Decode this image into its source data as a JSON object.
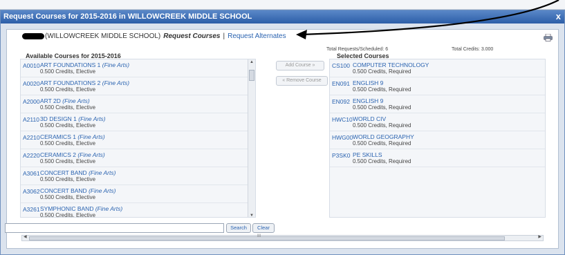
{
  "window": {
    "title": "Request Courses for 2015-2016 in WILLOWCREEK MIDDLE SCHOOL",
    "close_glyph": "x"
  },
  "header": {
    "school": "(WILLOWCREEK MIDDLE SCHOOL)",
    "request_courses": "Request Courses",
    "separator": "|",
    "request_alternates": "Request Alternates"
  },
  "totals": {
    "requests_label": "Total Requests/Scheduled:",
    "requests_value": "6",
    "credits_label": "Total Credits:",
    "credits_value": "3.000"
  },
  "available": {
    "heading": "Available Courses for 2015-2016",
    "courses": [
      {
        "code": "A0010",
        "name": "ART FOUNDATIONS 1",
        "category": "(Fine Arts)",
        "detail": "0.500 Credits, Elective"
      },
      {
        "code": "A0020",
        "name": "ART FOUNDATIONS 2",
        "category": "(Fine Arts)",
        "detail": "0.500 Credits, Elective"
      },
      {
        "code": "A2000",
        "name": "ART 2D",
        "category": "(Fine Arts)",
        "detail": "0.500 Credits, Elective"
      },
      {
        "code": "A2110",
        "name": "3D DESIGN 1",
        "category": "(Fine Arts)",
        "detail": "0.500 Credits, Elective"
      },
      {
        "code": "A2210",
        "name": "CERAMICS 1",
        "category": "(Fine Arts)",
        "detail": "0.500 Credits, Elective"
      },
      {
        "code": "A2220",
        "name": "CERAMICS 2",
        "category": "(Fine Arts)",
        "detail": "0.500 Credits, Elective"
      },
      {
        "code": "A3061",
        "name": "CONCERT BAND",
        "category": "(Fine Arts)",
        "detail": "0.500 Credits, Elective"
      },
      {
        "code": "A3062",
        "name": "CONCERT BAND",
        "category": "(Fine Arts)",
        "detail": "0.500 Credits, Elective"
      },
      {
        "code": "A3261",
        "name": "SYMPHONIC BAND",
        "category": "(Fine Arts)",
        "detail": "0.500 Credits, Elective"
      }
    ]
  },
  "buttons": {
    "add": "Add Course »",
    "remove": "« Remove Course",
    "search": "Search",
    "clear": "Clear"
  },
  "selected": {
    "heading": "Selected Courses",
    "courses": [
      {
        "code": "CS100",
        "name": "COMPUTER TECHNOLOGY",
        "detail": "0.500 Credits, Required"
      },
      {
        "code": "EN091",
        "name": "ENGLISH 9",
        "detail": "0.500 Credits, Required"
      },
      {
        "code": "EN092",
        "name": "ENGLISH 9",
        "detail": "0.500 Credits, Required"
      },
      {
        "code": "HWC10",
        "name": "WORLD CIV",
        "detail": "0.500 Credits, Required"
      },
      {
        "code": "HWG00",
        "name": "WORLD GEOGRAPHY",
        "detail": "0.500 Credits, Required"
      },
      {
        "code": "P3SK0",
        "name": "PE SKILLS",
        "detail": "0.500 Credits, Required"
      }
    ]
  },
  "search": {
    "value": "",
    "placeholder": ""
  },
  "scrollbar": {
    "grip": "III"
  },
  "icons": {
    "print": "printer-icon",
    "annotation": "arrow-annotation"
  },
  "colors": {
    "title_bar": "#2c5ea8",
    "link": "#2a63b0"
  }
}
